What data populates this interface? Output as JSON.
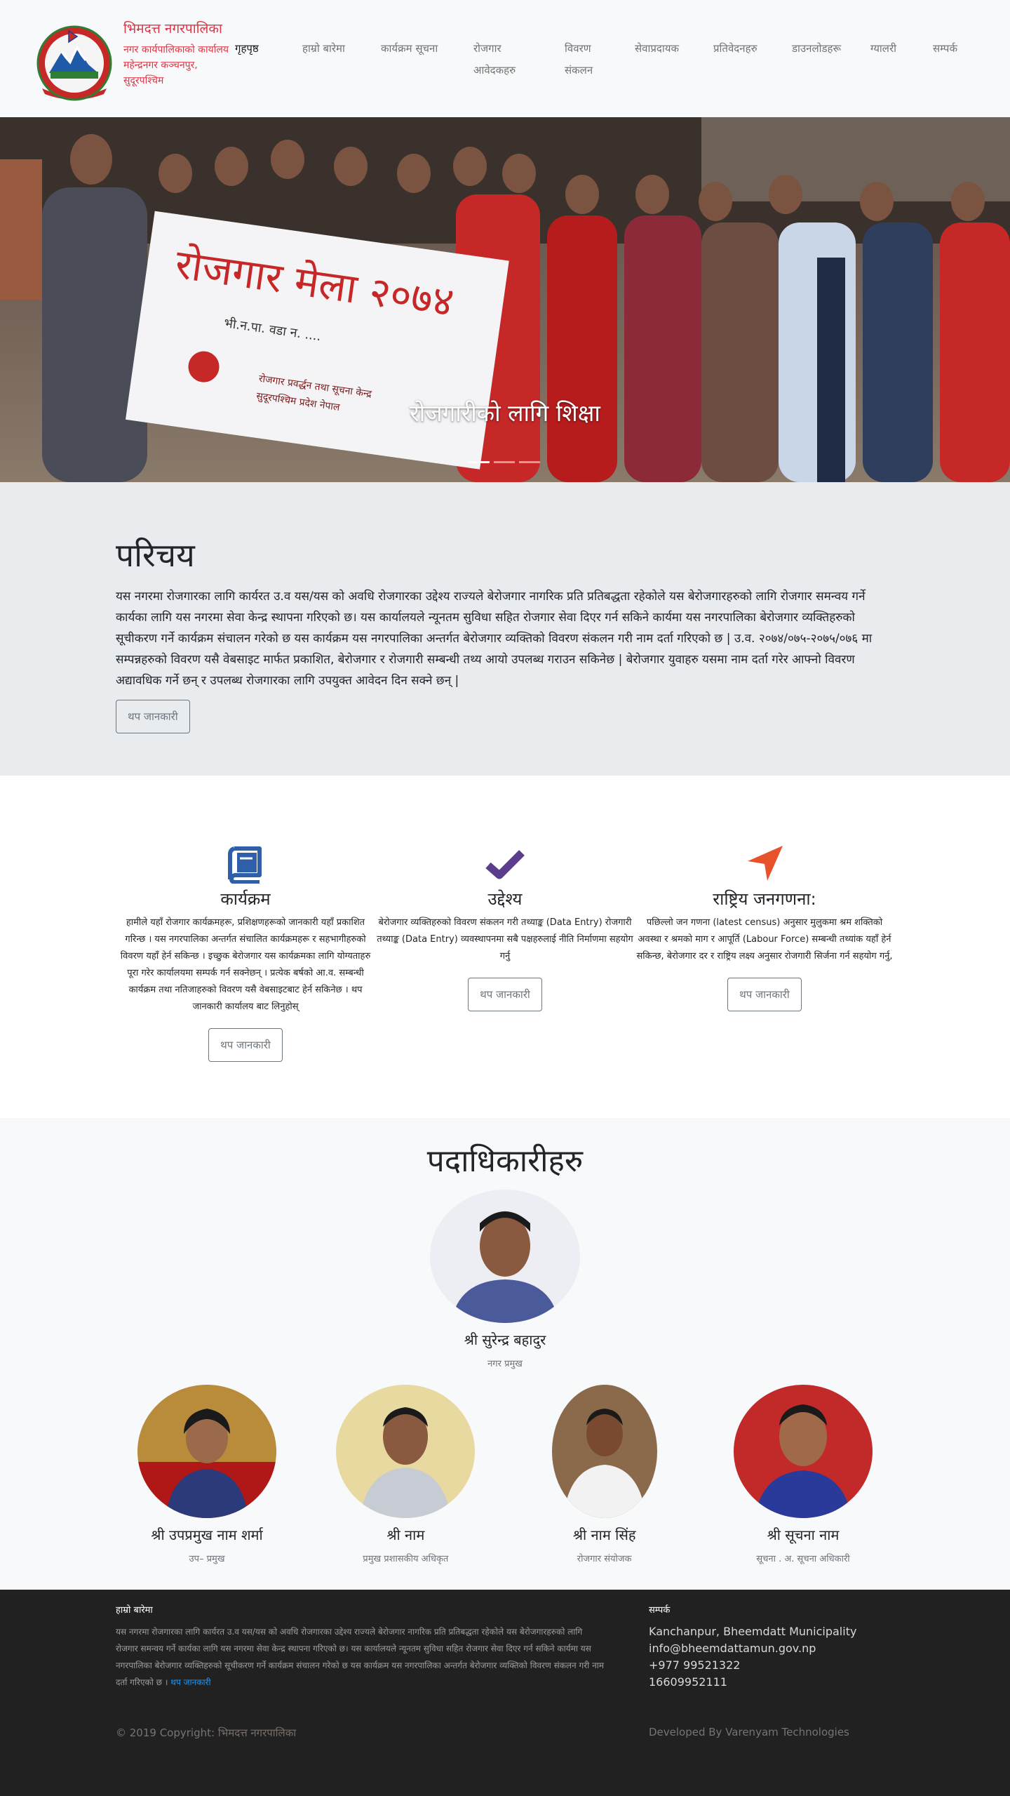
{
  "header": {
    "brand_title": "भिमदत्त नगरपालिका",
    "brand_sub_lines": [
      "नगर कार्यपालिकाको कार्यालय",
      "महेन्द्रनगर कञ्चनपुर,",
      "सुदूरपश्चिम"
    ],
    "nav": [
      {
        "label": "गृहपृष्ठ",
        "active": true
      },
      {
        "label": "हाम्रो बारेमा"
      },
      {
        "label": "कार्यक्रम सूचना"
      },
      {
        "label": "रोजगार आवेदकहरु"
      },
      {
        "label": "विवरण संकलन"
      },
      {
        "label": "सेवाप्रदायक"
      },
      {
        "label": "प्रतिवेदनहरु"
      },
      {
        "label": "डाउनलोडहरू"
      },
      {
        "label": "ग्यालरी"
      },
      {
        "label": "सम्पर्क"
      }
    ]
  },
  "hero": {
    "caption": "रोजगारीको लागि शिक्षा",
    "slides": 3,
    "active_slide": 1
  },
  "intro": {
    "heading": "परिचय",
    "text": "यस नगरमा रोजगारका लागि कार्यरत उ.व यस/यस को अवधि रोजगारका उद्देश्य राज्यले बेरोजगार नागरिक प्रति प्रतिबद्धता रहेकोले यस बेरोजगारहरुको लागि रोजगार समन्वय गर्ने कार्यका लागि यस नगरमा सेवा केन्द्र स्थापना गरिएको छ। यस कार्यालयले न्यूनतम सुविधा सहित रोजगार सेवा दिएर गर्न सकिने कार्यमा यस नगरपालिका बेरोजगार व्यक्तिहरुको सूचीकरण गर्ने कार्यक्रम संचालन गरेको छ यस कार्यक्रम यस नगरपालिका अन्तर्गत बेरोजगार व्यक्तिको विवरण संकलन गरी नाम दर्ता गरिएको छ | उ.व. २०७४/०७५-२०७५/०७६ मा सम्पन्नहरुको विवरण यसै वेबसाइट मार्फत प्रकाशित, बेरोजगार र रोजगारी सम्बन्धी तथ्य आयो उपलब्ध गराउन सकिनेछ | बेरोजगार युवाहरु यसमा नाम दर्ता गरेर आफ्नो विवरण अद्यावधिक गर्ने छन् र उपलब्ध रोजगारका लागि उपयुक्त आवेदन दिन सक्ने छन् |",
    "button": "थप जानकारी"
  },
  "features": [
    {
      "icon": "book-icon",
      "title": "कार्यक्रम",
      "text": "हामीले यहाँ रोजगार कार्यक्रमहरू, प्रशिक्षणहरूको जानकारी यहाँ प्रकाशित गरिन्छ । यस नगरपालिका अन्तर्गत संचालित कार्यक्रमहरू र सहभागीहरुको विवरण यहाँ हेर्न सकिन्छ । इच्छुक बेरोजगार यस कार्यक्रमका लागि योग्यताहरु पूरा गरेर कार्यालयमा सम्पर्क गर्न सक्नेछन् । प्रत्येक बर्षको आ.व. सम्बन्धी कार्यक्रम तथा नतिजाहरुको विवरण यसै वेबसाइटबाट हेर्न सकिनेछ । थप जानकारी कार्यालय बाट लिनुहोस्",
      "button": "थप जानकारी"
    },
    {
      "icon": "check-icon",
      "title": "उद्देश्य",
      "text": "बेरोजगार व्यक्तिहरुको विवरण संकलन गरी तथ्याङ्क (Data Entry) रोजगारी तथ्याङ्क (Data Entry) व्यवस्थापनमा सबै पक्षहरुलाई नीति निर्माणमा सहयोग गर्नु",
      "button": "थप जानकारी"
    },
    {
      "icon": "location-arrow-icon",
      "title": "राष्ट्रिय जनगणना:",
      "text": "पछिल्लो जन गणना (latest census) अनुसार मुलुकमा श्रम शक्तिको अवस्था र श्रमको माग र आपूर्ति (Labour Force) सम्बन्धी तथ्यांक यहाँ हेर्न सकिन्छ, बेरोजगार दर र राष्ट्रिय लक्ष्य अनुसार रोजगारी सिर्जना गर्न सहयोग गर्नु,",
      "button": "थप जानकारी"
    }
  ],
  "team": {
    "heading": "पदाधिकारीहरु",
    "lead": {
      "name": "श्री सुरेन्द्र बहादुर",
      "role": "नगर प्रमुख"
    },
    "members": [
      {
        "name": "श्री उपप्रमुख नाम शर्मा",
        "role": "उप– प्रमुख"
      },
      {
        "name": "श्री नाम",
        "role": "प्रमुख प्रशासकीय अधिकृत"
      },
      {
        "name": "श्री नाम सिंह",
        "role": "रोजगार संयोजक"
      },
      {
        "name": "श्री सूचना नाम",
        "role": "सूचना . अ. सूचना अधिकारी"
      }
    ]
  },
  "footer": {
    "about_heading": "हाम्रो बारेमा",
    "about_text": "यस नगरमा रोजगारका लागि कार्यरत उ.व यस/यस को अवधि रोजगारका उद्देश्य राज्यले बेरोजगार नागरिक प्रति प्रतिबद्धता रहेकोले यस बेरोजगारहरुको लागि रोजगार समन्वय गर्ने कार्यका लागि यस नगरमा सेवा केन्द्र स्थापना गरिएको छ। यस कार्यालयले न्यूनतम सुविधा सहित रोजगार सेवा दिएर गर्न सकिने कार्यमा यस नगरपालिका बेरोजगार व्यक्तिहरुको सूचीकरण गर्ने कार्यक्रम संचालन गरेको छ यस कार्यक्रम यस नगरपालिका अन्तर्गत बेरोजगार व्यक्तिको विवरण संकलन गरी नाम दर्ता गरिएको छ",
    "about_link": "थप जानकारी",
    "contact_heading": "सम्पर्क",
    "contacts": [
      "Kanchanpur, Bheemdatt Municipality",
      "info@bheemdattamun.gov.np",
      "+977 99521322",
      "16609952111"
    ],
    "copyright_prefix": "© 2019 Copyright:",
    "copyright_link": "भिमदत्त नगरपालिका",
    "developer": "Developed By Varenyam Technologies"
  },
  "colors": {
    "brand": "#dc3545",
    "icon_book": "#2e5fa8",
    "icon_check": "#5a3d8c",
    "icon_arrow": "#e8522b",
    "footer_bg": "#212121"
  }
}
